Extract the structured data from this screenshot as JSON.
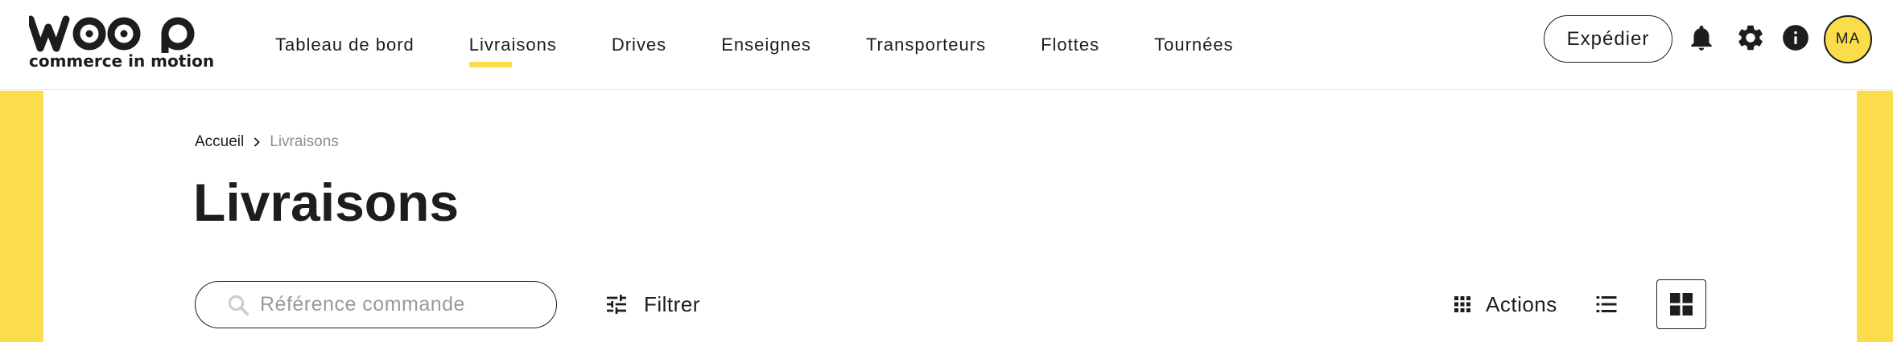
{
  "brand": {
    "name": "woop",
    "tagline": "commerce in motion",
    "accent": "#fbdd4b",
    "ink": "#1d1d1b"
  },
  "nav": {
    "items": [
      {
        "label": "Tableau de bord",
        "active": false
      },
      {
        "label": "Livraisons",
        "active": true
      },
      {
        "label": "Drives",
        "active": false
      },
      {
        "label": "Enseignes",
        "active": false
      },
      {
        "label": "Transporteurs",
        "active": false
      },
      {
        "label": "Flottes",
        "active": false
      },
      {
        "label": "Tournées",
        "active": false
      }
    ]
  },
  "header_actions": {
    "primary_label": "Expédier",
    "notifications_icon": "bell-icon",
    "settings_icon": "gear-icon",
    "info_icon": "info-icon",
    "avatar_initials": "MA"
  },
  "breadcrumb": {
    "home": "Accueil",
    "current": "Livraisons"
  },
  "page": {
    "title": "Livraisons"
  },
  "toolbar": {
    "search_placeholder": "Référence commande",
    "search_value": "",
    "filter_label": "Filtrer",
    "actions_label": "Actions",
    "view_mode": "grid"
  }
}
